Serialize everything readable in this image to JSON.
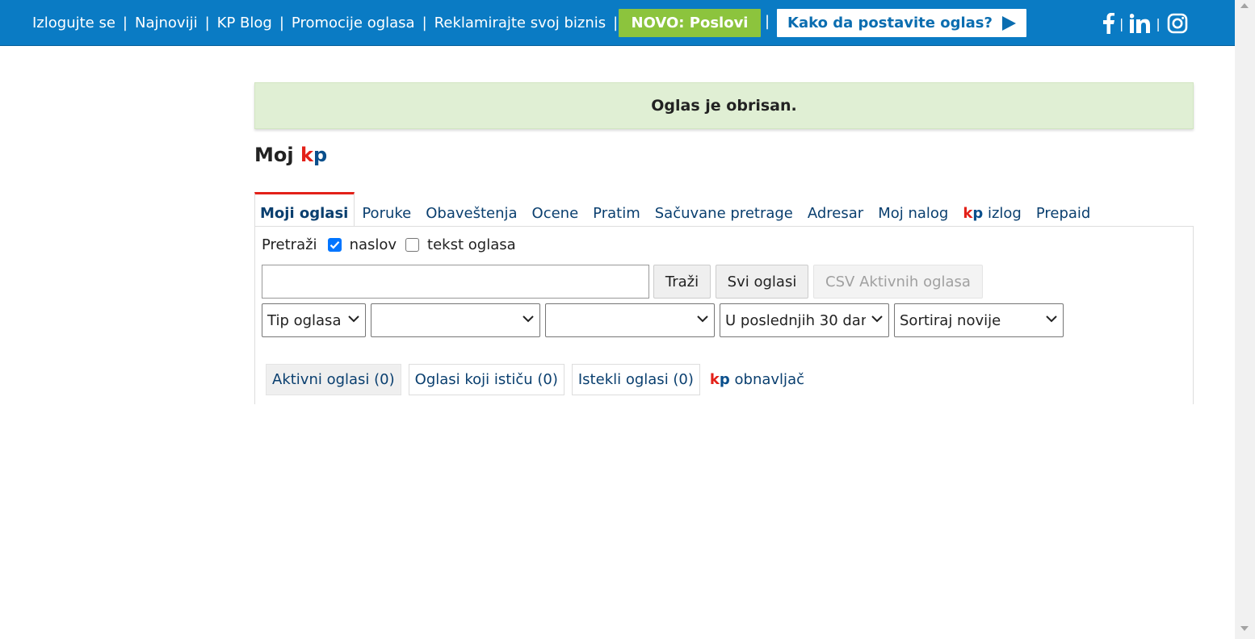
{
  "topbar": {
    "links": [
      "Izlogujte se",
      "Najnoviji",
      "KP Blog",
      "Promocije oglasa",
      "Reklamirajte svoj biznis"
    ],
    "separator": "|",
    "novo_button": "NOVO: Poslovi",
    "kako_button": "Kako da postavite oglas?",
    "social_icons": [
      "facebook-icon",
      "linkedin-icon",
      "instagram-icon"
    ],
    "colors": {
      "bar": "#0a7bc4",
      "novo": "#8cc43d",
      "kako_text": "#0a6db0"
    }
  },
  "notice": {
    "text": "Oglas je obrisan."
  },
  "title": {
    "prefix": "Moj",
    "kp_k": "k",
    "kp_p": "p"
  },
  "tabs": [
    {
      "label": "Moji oglasi",
      "active": true
    },
    {
      "label": "Poruke"
    },
    {
      "label": "Obaveštenja"
    },
    {
      "label": "Ocene"
    },
    {
      "label": "Pratim"
    },
    {
      "label": "Sačuvane pretrage"
    },
    {
      "label": "Adresar"
    },
    {
      "label": "Moj nalog"
    },
    {
      "label": "izlog",
      "kp_prefix": true
    },
    {
      "label": "Prepaid"
    }
  ],
  "search": {
    "label": "Pretraži",
    "options": [
      {
        "label": "naslov",
        "checked": true
      },
      {
        "label": "tekst oglasa",
        "checked": false
      }
    ],
    "input_value": "",
    "buttons": {
      "search": "Traži",
      "all": "Svi oglasi",
      "csv": "CSV Aktivnih oglasa"
    }
  },
  "filters": {
    "type": "Tip oglasa",
    "select2": "",
    "select3": "",
    "period": "U poslednjih 30 dana",
    "sort": "Sortiraj novije"
  },
  "subtabs": [
    {
      "label": "Aktivni oglasi (0)",
      "active": true
    },
    {
      "label": "Oglasi koji ističu (0)"
    },
    {
      "label": "Istekli oglasi (0)"
    }
  ],
  "obnavljac": {
    "label": "obnavljač"
  }
}
